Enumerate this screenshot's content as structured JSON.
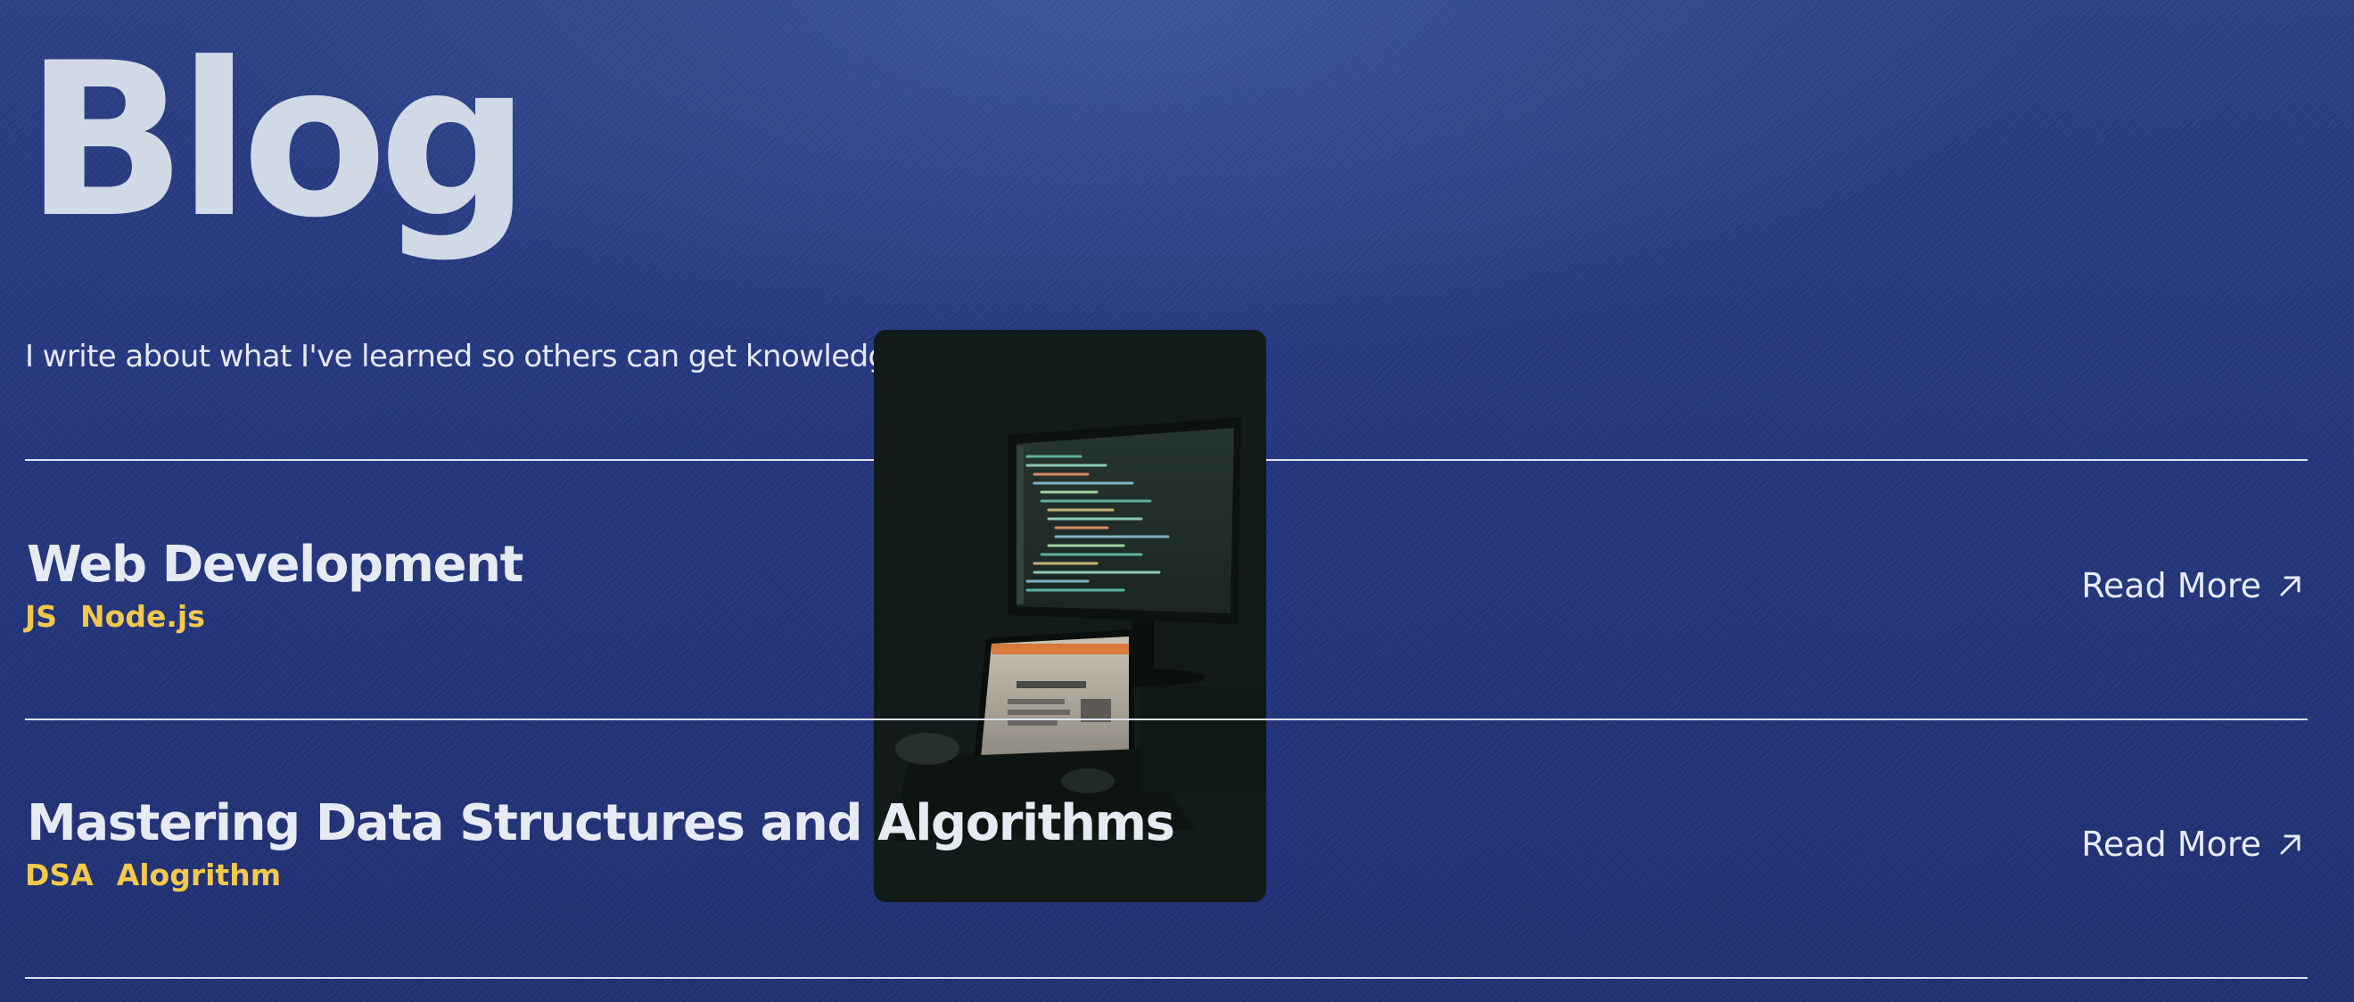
{
  "page": {
    "title": "Blog",
    "subtitle": "I write about what I've learned so others can get knowledge in simplified way."
  },
  "posts": [
    {
      "title": "Web Development",
      "tags": [
        "JS",
        "Node.js"
      ],
      "read_more_label": "Read More",
      "icon": "arrow-up-right-icon"
    },
    {
      "title": "Mastering Data Structures and Algorithms",
      "tags": [
        "DSA",
        "Alogrithm"
      ],
      "read_more_label": "Read More",
      "icon": "arrow-up-right-icon"
    }
  ],
  "preview_image": {
    "subject": "laptop-and-code-monitor-photo"
  },
  "colors": {
    "background": "#253780",
    "title": "#d1d9e6",
    "text": "#e6ebf3",
    "tag": "#f2c94c",
    "divider": "#dde3ee",
    "preview_overlay": "#121b19"
  }
}
